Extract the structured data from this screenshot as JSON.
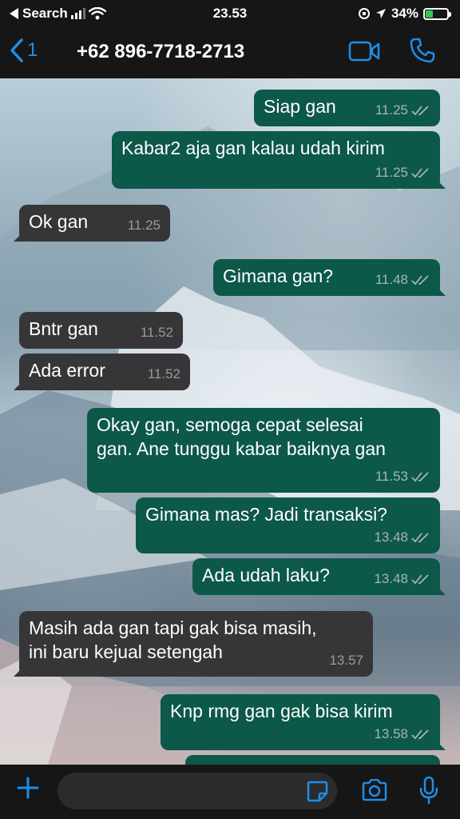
{
  "status_bar": {
    "back_app": "Search",
    "time": "23.53",
    "battery": "34%",
    "battery_level": 0.34
  },
  "header": {
    "back_count": "1",
    "contact": "+62 896-7718-2713"
  },
  "messages": [
    {
      "dir": "out",
      "lines": [
        "Siap gan"
      ],
      "time": "11.25"
    },
    {
      "dir": "out",
      "lines": [
        "Kabar2 aja gan kalau udah kirim"
      ],
      "time": "11.25"
    },
    {
      "dir": "in",
      "lines": [
        "Ok gan"
      ],
      "time": "11.25"
    },
    {
      "dir": "out",
      "lines": [
        "Gimana gan?"
      ],
      "time": "11.48"
    },
    {
      "dir": "in",
      "lines": [
        "Bntr gan"
      ],
      "time": "11.52"
    },
    {
      "dir": "in",
      "lines": [
        "Ada error"
      ],
      "time": "11.52"
    },
    {
      "dir": "out",
      "lines": [
        "Okay gan, semoga cepat selesai",
        "gan. Ane tunggu kabar baiknya gan"
      ],
      "time": "11.53"
    },
    {
      "dir": "out",
      "lines": [
        "Gimana mas? Jadi transaksi?"
      ],
      "time": "13.48"
    },
    {
      "dir": "out",
      "lines": [
        "Ada udah laku?"
      ],
      "time": "13.48"
    },
    {
      "dir": "in",
      "lines": [
        "Masih ada gan tapi gak bisa masih,",
        "ini baru kejual setengah"
      ],
      "time": "13.57"
    },
    {
      "dir": "out",
      "lines": [
        "Knp rmg gan gak bisa kirim"
      ],
      "time": "13.58"
    }
  ],
  "colors": {
    "outgoing_bubble": "#0c5849",
    "incoming_bubble": "#363638",
    "accent": "#1e8ee8"
  }
}
